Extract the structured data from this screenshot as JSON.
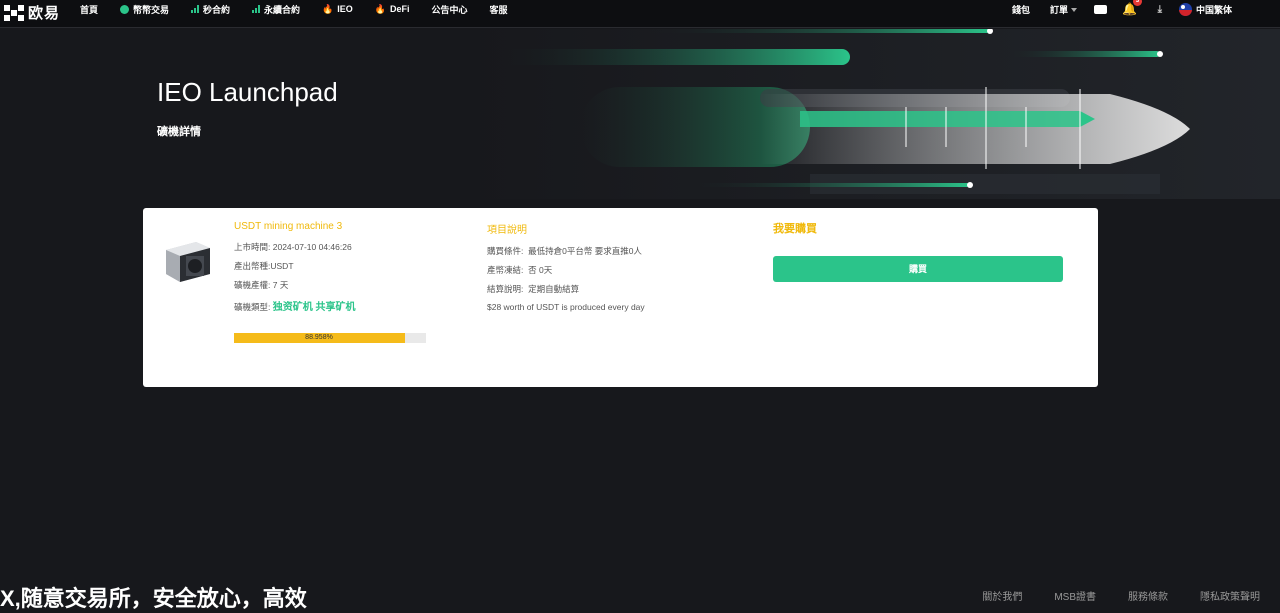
{
  "header": {
    "logo_text": "欧易",
    "nav": [
      "首頁",
      "幣幣交易",
      "秒合約",
      "永續合約",
      "IEO",
      "DeFi",
      "公告中心",
      "客服"
    ],
    "wallet": "錢包",
    "orders": "訂單",
    "notification_count": "3",
    "language": "中国繁体"
  },
  "hero": {
    "title": "IEO Launchpad",
    "subtitle": "礦機詳情"
  },
  "miner": {
    "name": "USDT mining machine 3",
    "listing_time_label": "上市時間:",
    "listing_time": "2024-07-10 04:46:26",
    "output_coin_label": "產出幣種:",
    "output_coin": "USDT",
    "cycle_label": "礦機產權:",
    "cycle": "7 天",
    "type_label": "礦機類型:",
    "type": "独资矿机 共享矿机",
    "progress_label": "88.958%",
    "progress": 88.958
  },
  "project": {
    "title": "項目說明",
    "purchase_cond_label": "購買條件:",
    "purchase_cond": "最低持倉0平台幣 要求直推0人",
    "freeze_label": "產幣凍結:",
    "freeze": "否 0天",
    "settle_label": "結算說明:",
    "settle": "定期自動結算",
    "description": "$28 worth of USDT is produced every day"
  },
  "purchase": {
    "title": "我要購買",
    "button": "購買"
  },
  "footer": {
    "slogan": "X,随意交易所，安全放心，高效",
    "links": [
      "關於我們",
      "MSB證書",
      "服務條款",
      "隱私政策聲明"
    ]
  },
  "colors": {
    "accent_green": "#2bc48a",
    "accent_gold": "#f0b90b",
    "progress": "#f5bb1a"
  }
}
